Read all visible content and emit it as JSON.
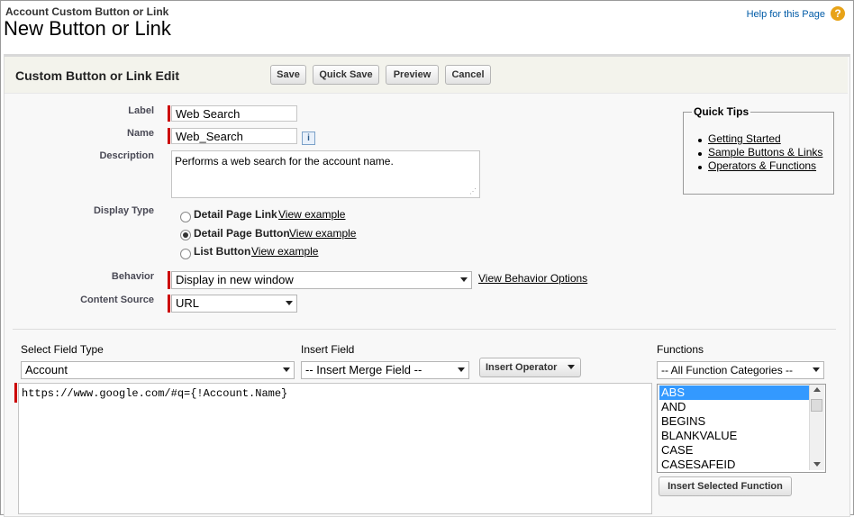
{
  "header": {
    "breadcrumb": "Account Custom Button or Link",
    "page_title": "New Button or Link",
    "help_link": "Help for this Page",
    "help_icon": "question-icon"
  },
  "panel": {
    "title": "Custom Button or Link Edit",
    "buttons": {
      "save": "Save",
      "quick_save": "Quick Save",
      "preview": "Preview",
      "cancel": "Cancel"
    }
  },
  "form": {
    "label": {
      "caption": "Label",
      "value": "Web Search"
    },
    "name": {
      "caption": "Name",
      "value": "Web_Search",
      "info_icon": "i"
    },
    "description": {
      "caption": "Description",
      "value": "Performs a web search for the account name."
    },
    "display_type": {
      "caption": "Display Type",
      "options": [
        {
          "label": "Detail Page Link",
          "link": "View example",
          "checked": false
        },
        {
          "label": "Detail Page Button",
          "link": "View example",
          "checked": true
        },
        {
          "label": "List Button",
          "link": "View example",
          "checked": false
        }
      ]
    },
    "behavior": {
      "caption": "Behavior",
      "value": "Display in new window",
      "link": "View Behavior Options"
    },
    "content_source": {
      "caption": "Content Source",
      "value": "URL"
    }
  },
  "quick_tips": {
    "title": "Quick Tips",
    "items": [
      "Getting Started",
      "Sample Buttons & Links",
      "Operators & Functions"
    ]
  },
  "formula_editor": {
    "select_field_type": {
      "caption": "Select Field Type",
      "value": "Account"
    },
    "insert_field": {
      "caption": "Insert Field",
      "value": "-- Insert Merge Field --"
    },
    "insert_operator": "Insert Operator",
    "functions": {
      "caption": "Functions",
      "category": "-- All Function Categories --",
      "items": [
        "ABS",
        "AND",
        "BEGINS",
        "BLANKVALUE",
        "CASE",
        "CASESAFEID"
      ],
      "selected": "ABS",
      "insert_button": "Insert Selected Function"
    },
    "formula": "https://www.google.com/#q={!Account.Name}"
  },
  "colors": {
    "required": "#cc0000",
    "selected": "#3399ff",
    "help_icon": "#e8a317"
  }
}
